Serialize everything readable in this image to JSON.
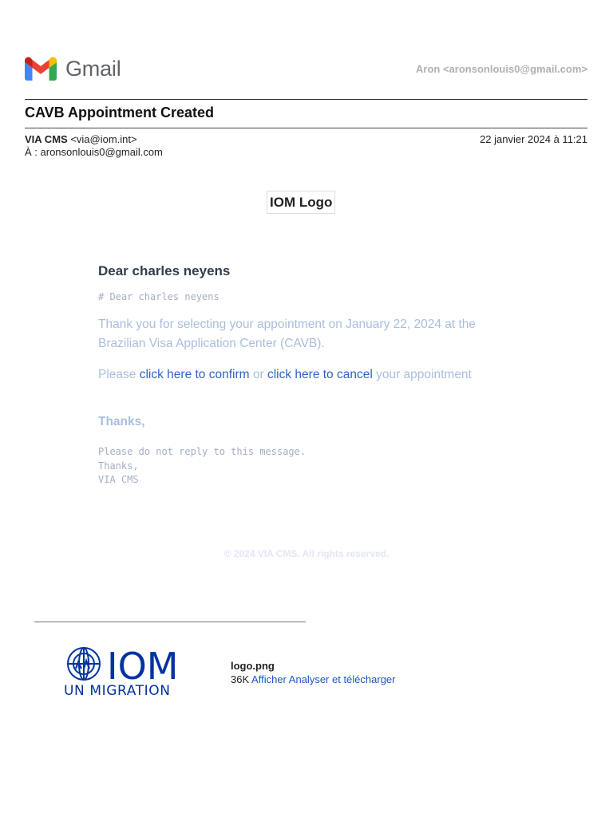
{
  "header": {
    "brand": "Gmail",
    "account": "Aron <aronsonlouis0@gmail.com>"
  },
  "email": {
    "subject": "CAVB Appointment Created",
    "sender_name": "VIA CMS",
    "sender_address": "<via@iom.int>",
    "date": "22 janvier 2024 à 11:21",
    "to": "À : aronsonlouis0@gmail.com"
  },
  "body": {
    "logo_alt": "IOM Logo",
    "greeting": "Dear charles neyens",
    "markdown_heading": "# Dear charles neyens",
    "paragraph1": "Thank you for selecting your appointment on January 22, 2024 at the Brazilian Visa Application Center (CAVB).",
    "please": "Please",
    "confirm_link": "click here to confirm",
    "or": "or",
    "cancel_link": "click here to cancel",
    "your_appointment": "your appointment",
    "thanks": "Thanks,",
    "signature": [
      "Please do not reply to this message.",
      "Thanks,",
      "VIA CMS"
    ],
    "footer": "© 2024 VIA CMS. All rights reserved."
  },
  "attachment": {
    "logo_text_main": "IOM",
    "logo_text_sub": "UN MIGRATION",
    "filename": "logo.png",
    "size": "36K",
    "view_link": "Afficher",
    "analyze_link": "Analyser et télécharger"
  },
  "colors": {
    "iom_blue": "#0033a0",
    "link_blue": "#2f63c8"
  }
}
